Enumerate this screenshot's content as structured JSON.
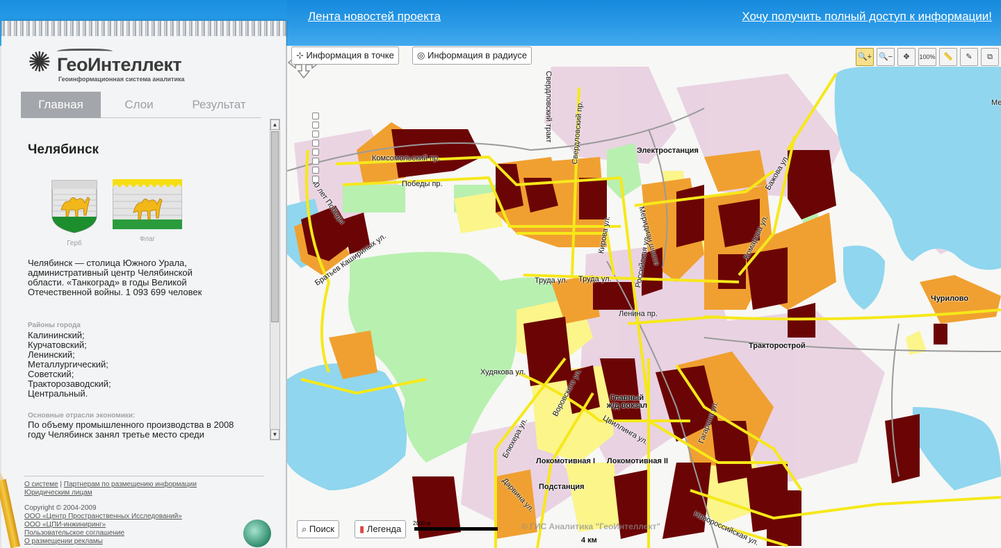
{
  "header": {
    "news_link": "Лента новостей проекта",
    "access_link": "Хочу получить полный доступ к информации!"
  },
  "logo": {
    "title": "ГеоИнтеллект",
    "subtitle": "Геоинформационная система аналитика"
  },
  "tabs": [
    {
      "label": "Главная",
      "active": true
    },
    {
      "label": "Слои",
      "active": false
    },
    {
      "label": "Результат",
      "active": false
    }
  ],
  "city": {
    "title": "Челябинск",
    "coat_caption": "Герб",
    "flag_caption": "Флаг",
    "description": "Челябинск — столица Южного Урала, административный центр Челябинской области. «Танкоград» в годы Великой Отечественной войны. 1 093 699 человек",
    "districts_heading": "Районы города",
    "districts": [
      "Калининский;",
      "Курчатовский;",
      "Ленинский;",
      "Металлургический;",
      "Советский;",
      "Тракторозаводский;",
      "Центральный."
    ],
    "econ_heading": "Основные отрасли экономики:",
    "econ_text": "По объему промышленного производства в 2008 году Челябинск занял третье место среди"
  },
  "footer": {
    "links": [
      "О системе",
      "Партнерам по размещению информации",
      "Юридическим лицам"
    ],
    "copyright": "Copyright © 2004-2009",
    "credits": [
      "ООО «Центр Пространственных Исследований»",
      "ООО «ЦПИ-инжиниринг»",
      "Пользовательское соглашение",
      "О размещении рекламы"
    ]
  },
  "map": {
    "btn_point": "Информация в точке",
    "btn_radius": "Информация в радиусе",
    "tools": [
      {
        "name": "zoom-in-icon",
        "glyph": "🔍+"
      },
      {
        "name": "zoom-out-icon",
        "glyph": "🔍−"
      },
      {
        "name": "pan-icon",
        "glyph": "✥"
      },
      {
        "name": "zoom-100-icon",
        "glyph": "100%"
      },
      {
        "name": "ruler-icon",
        "glyph": "📏"
      },
      {
        "name": "pen-icon",
        "glyph": "✎"
      },
      {
        "name": "fullscreen-icon",
        "glyph": "⧉"
      }
    ],
    "btn_search": "Поиск",
    "btn_legend": "Легенда",
    "scale_label": "2000 м",
    "copyright": "© ГИС Аналитика \"ГеоИнтеллект\"",
    "places": [
      "Электростанция",
      "Тракторострой",
      "Чурилово",
      "Главный ж/д вокзал",
      "Локомотивная I",
      "Локомотивная II",
      "Подстанция",
      "4 км",
      "Ме"
    ],
    "streets": [
      "Комсомольский пр.",
      "Победы пр.",
      "40 лет Победы",
      "Братьев Кашириных ул.",
      "Свердловский тракт",
      "Свердловский пр.",
      "Кирова ул.",
      "Российская ул.",
      "Меридиан шоссе",
      "Бажова ул.",
      "Комарова ул.",
      "Труда ул.",
      "Труда ул.",
      "Ленина пр.",
      "Худякова ул.",
      "Воровского ул.",
      "Блюхера ул.",
      "Цвиллинга ул.",
      "Гагарина ул.",
      "Дарвина ул.",
      "Новороссийская ул."
    ]
  },
  "colors": {
    "banner": "#1b8ee0",
    "dark_red": "#6b0505",
    "orange": "#f0a030",
    "light_yellow": "#fbf58a",
    "road": "#f6e81a",
    "water": "#8fd6ee",
    "park": "#b8f0b0",
    "industrial": "#e8cfe0"
  }
}
